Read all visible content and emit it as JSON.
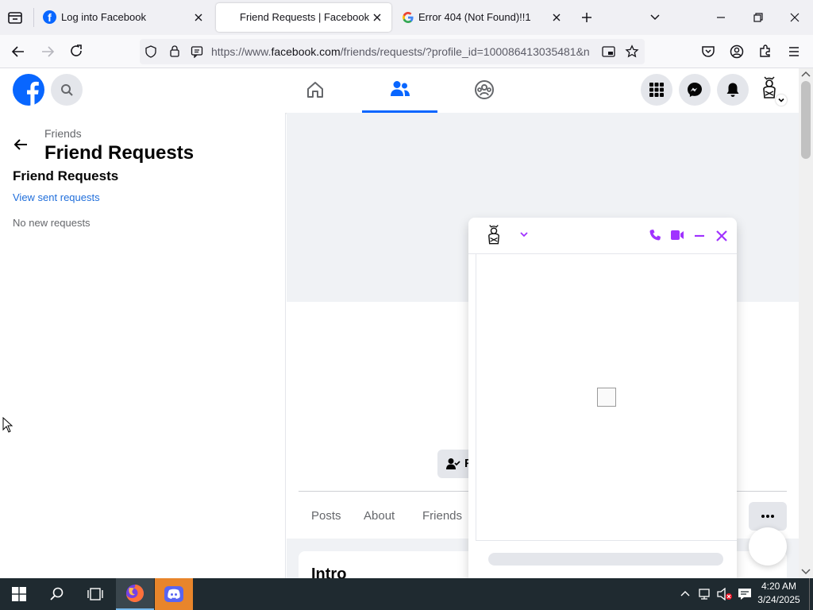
{
  "browser": {
    "tabs": [
      {
        "title": "Log into Facebook",
        "active": false
      },
      {
        "title": "Friend Requests | Facebook",
        "active": true
      },
      {
        "title": "Error 404 (Not Found)!!1",
        "active": false
      }
    ],
    "url_prefix": "https://www.",
    "url_domain": "facebook.com",
    "url_rest": "/friends/requests/?profile_id=100086413035481&n"
  },
  "sidebar": {
    "breadcrumb": "Friends",
    "title": "Friend Requests",
    "section_title": "Friend Requests",
    "sent_link": "View sent requests",
    "empty_text": "No new requests"
  },
  "profile": {
    "action_button_label": "Fr",
    "tabs": [
      "Posts",
      "About",
      "Friends"
    ],
    "intro_title": "Intro"
  },
  "taskbar": {
    "time": "4:20 AM",
    "date": "3/24/2025"
  },
  "colors": {
    "facebook_blue": "#0866ff",
    "messenger_purple": "#a033ff",
    "taskbar": "#1f2a30"
  }
}
